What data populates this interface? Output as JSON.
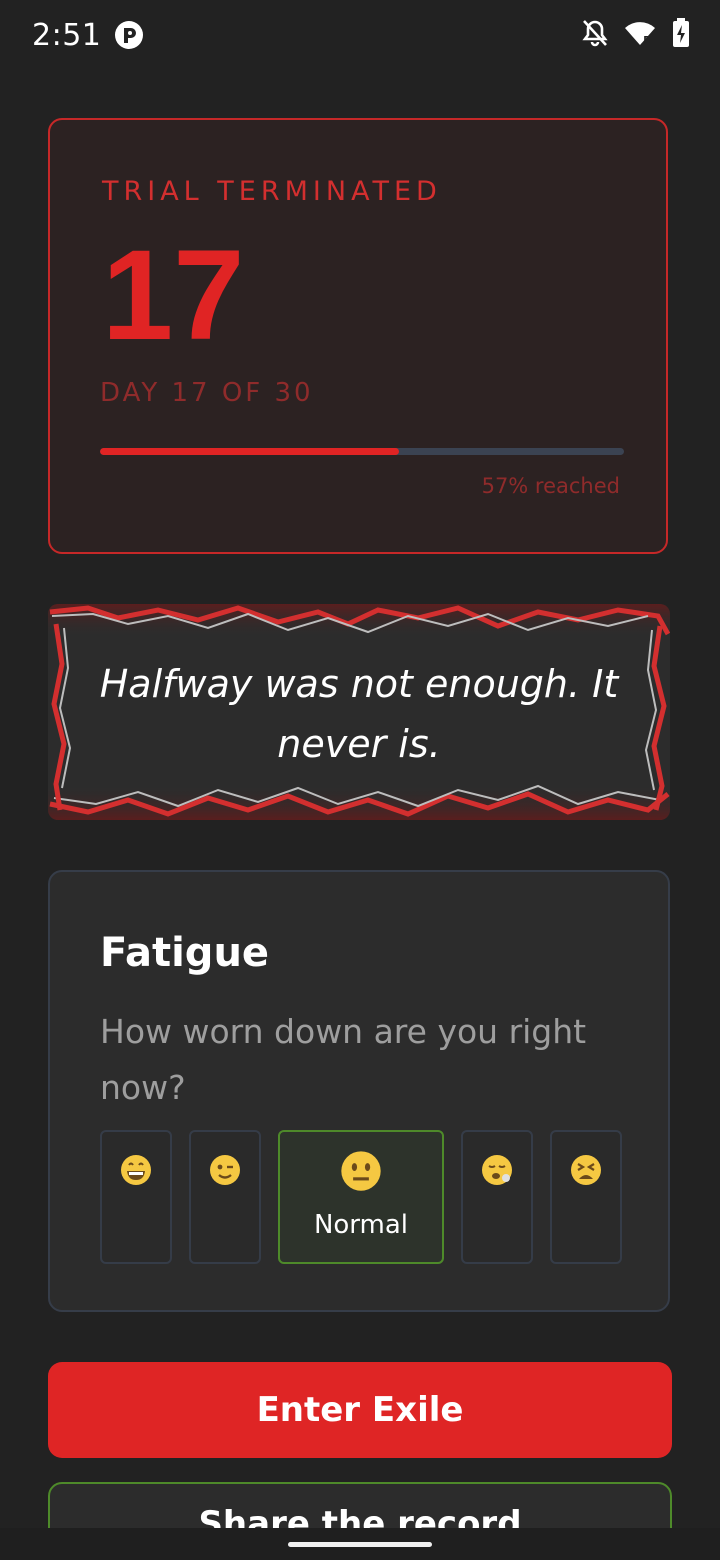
{
  "status_bar": {
    "time": "2:51",
    "app_badge_icon": "app-badge-icon",
    "icons": [
      "notifications-off-icon",
      "wifi-icon",
      "battery-charging-icon"
    ]
  },
  "trial": {
    "status_label": "TRIAL TERMINATED",
    "day_number": "17",
    "day_of_label": "DAY 17 OF 30",
    "progress_fraction": 0.57,
    "progress_label": "57% reached",
    "accent_color": "#e02424"
  },
  "quote": {
    "text": "Halfway was not enough. It never is."
  },
  "fatigue": {
    "title": "Fatigue",
    "question": "How worn down are you right now?",
    "selected_index": 2,
    "options": [
      {
        "icon": "grinning-face-icon",
        "label": ""
      },
      {
        "icon": "winking-face-icon",
        "label": ""
      },
      {
        "icon": "neutral-face-icon",
        "label": "Normal"
      },
      {
        "icon": "exhausted-face-icon",
        "label": ""
      },
      {
        "icon": "tired-face-icon",
        "label": ""
      }
    ]
  },
  "actions": {
    "primary_label": "Enter Exile",
    "secondary_label": "Share the record"
  }
}
